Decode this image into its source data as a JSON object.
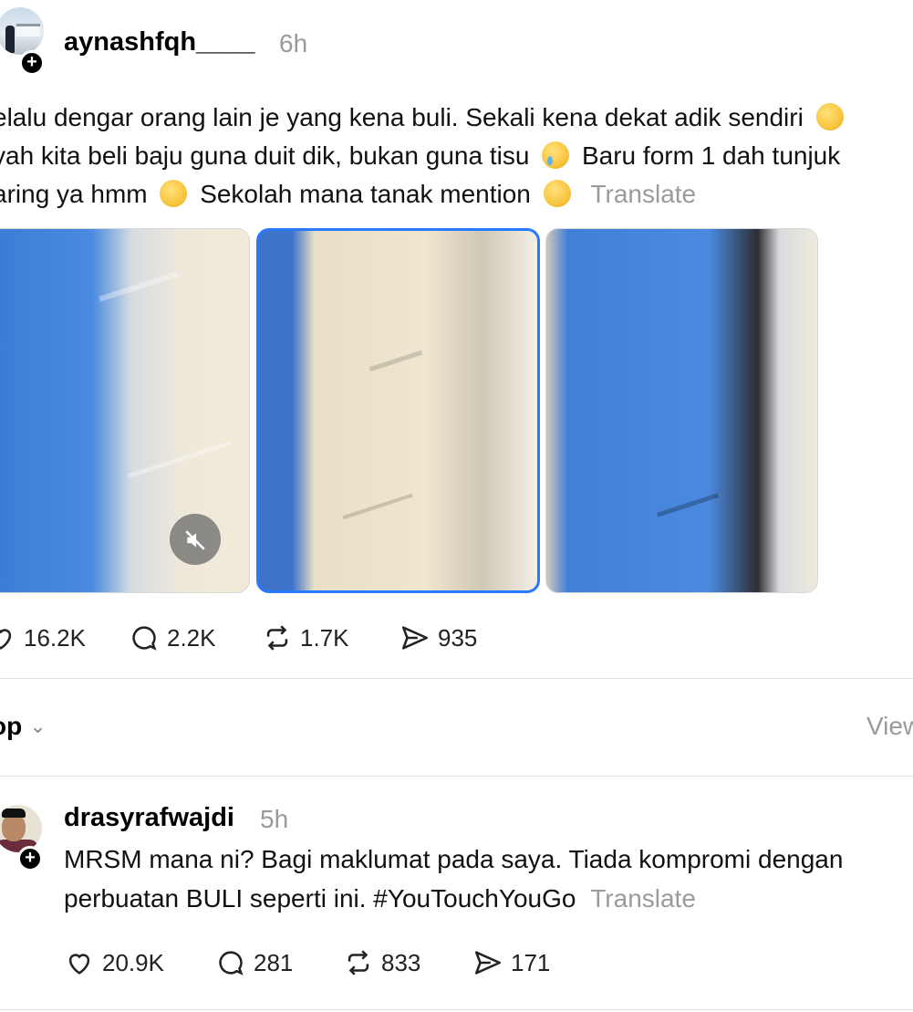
{
  "post": {
    "username": "aynashfqh____",
    "time": "6h",
    "lines": [
      "elalu dengar orang lain je yang kena buli. Sekali kena dekat adik sendiri",
      "yah kita beli baju guna duit dik, bukan guna tisu",
      "Baru form 1 dah tunjuk",
      "aring ya hmm",
      "Sekolah mana tanak mention"
    ],
    "translate": "Translate",
    "follow_symbol": "+",
    "stats": {
      "likes": "16.2K",
      "comments": "2.2K",
      "reposts": "1.7K",
      "shares": "935"
    }
  },
  "sort": {
    "label": "op",
    "chevron": "⌄",
    "view": "View"
  },
  "reply": {
    "username": "drasyrafwajdi",
    "time": "5h",
    "lines": [
      "MRSM mana ni? Bagi maklumat pada saya. Tiada kompromi dengan",
      "perbuatan BULI seperti ini. #YouTouchYouGo"
    ],
    "translate": "Translate",
    "follow_symbol": "+",
    "stats": {
      "likes": "20.9K",
      "comments": "281",
      "reposts": "833",
      "shares": "171"
    }
  },
  "icons": {
    "mute": "speaker-muted-icon",
    "like": "heart-icon",
    "comment": "comment-icon",
    "repost": "repost-icon",
    "share": "share-icon"
  },
  "colors": {
    "selected_border": "#2a79ff",
    "muted_text": "#9a9a9a"
  }
}
